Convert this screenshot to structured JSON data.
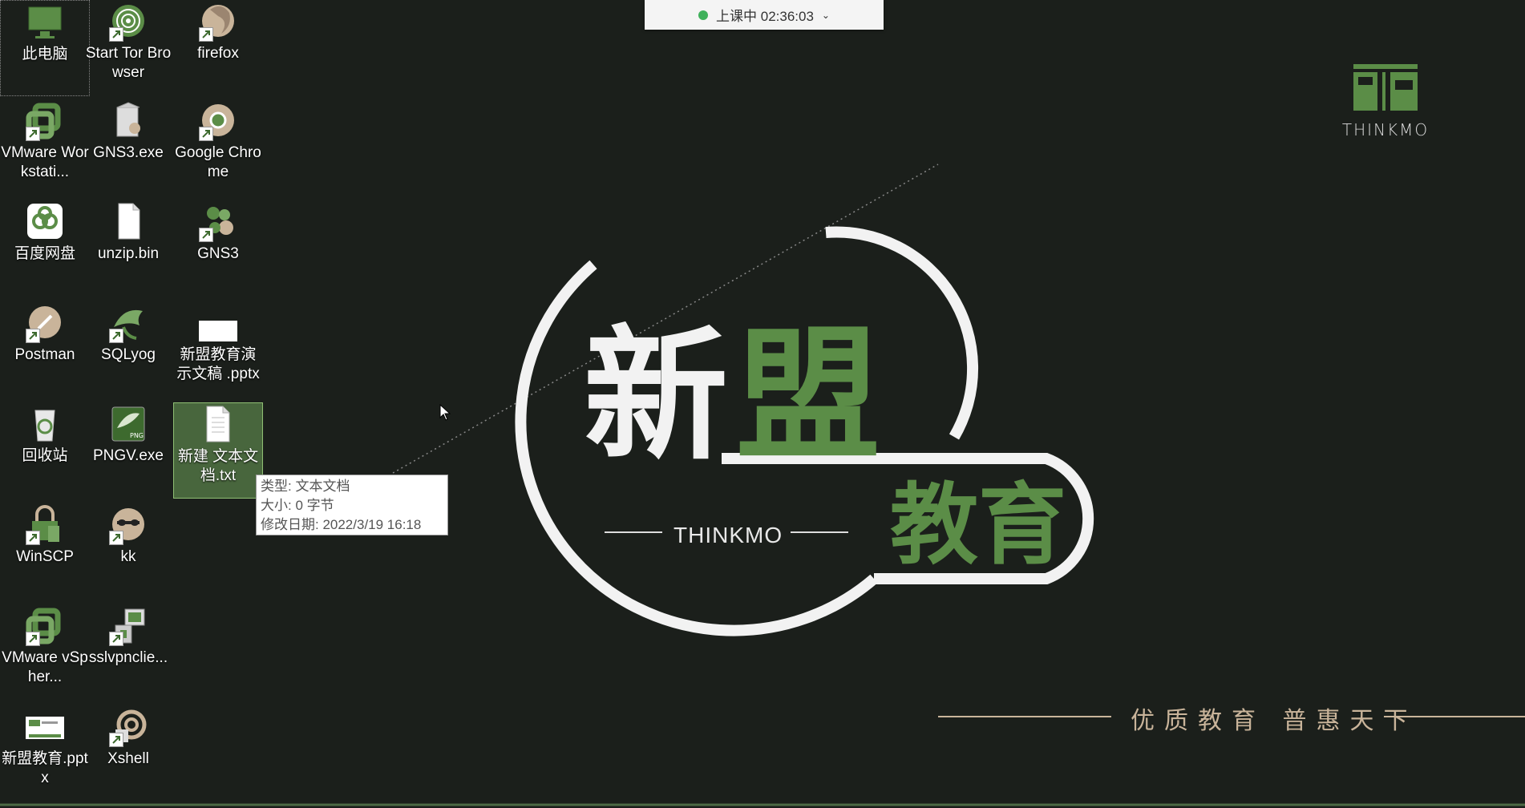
{
  "status_bar": {
    "text": "上课中 02:36:03",
    "status_color": "#3fb15b"
  },
  "desktop_icons": [
    {
      "label": "此电脑",
      "icon": "computer-icon",
      "shortcut": false
    },
    {
      "label": "VMware Workstati...",
      "icon": "vmware-icon",
      "shortcut": true
    },
    {
      "label": "百度网盘",
      "icon": "baidu-netdisk-icon",
      "shortcut": true
    },
    {
      "label": "Postman",
      "icon": "postman-icon",
      "shortcut": true
    },
    {
      "label": "回收站",
      "icon": "recycle-bin-icon",
      "shortcut": false
    },
    {
      "label": "WinSCP",
      "icon": "winscp-icon",
      "shortcut": true
    },
    {
      "label": "VMware vSpher...",
      "icon": "vmware-vsphere-icon",
      "shortcut": true
    },
    {
      "label": "新盟教育.pptx",
      "icon": "pptx-icon",
      "shortcut": false
    },
    {
      "label": "Start Tor Browser",
      "icon": "tor-icon",
      "shortcut": true
    },
    {
      "label": "GNS3.exe",
      "icon": "gns3-installer-icon",
      "shortcut": false
    },
    {
      "label": "unzip.bin",
      "icon": "file-icon",
      "shortcut": false
    },
    {
      "label": "SQLyog",
      "icon": "sqlyog-icon",
      "shortcut": true
    },
    {
      "label": "PNGV.exe",
      "icon": "pngv-icon",
      "shortcut": false
    },
    {
      "label": "kk",
      "icon": "kk-icon",
      "shortcut": true
    },
    {
      "label": "sslvpnclie...",
      "icon": "sslvpn-icon",
      "shortcut": true
    },
    {
      "label": "Xshell",
      "icon": "xshell-icon",
      "shortcut": true
    },
    {
      "label": "firefox",
      "icon": "firefox-icon",
      "shortcut": true
    },
    {
      "label": "Google Chrome",
      "icon": "chrome-icon",
      "shortcut": true
    },
    {
      "label": "GNS3",
      "icon": "gns3-icon",
      "shortcut": true
    },
    {
      "label": "新盟教育演示文稿 .pptx",
      "icon": "pptx-blank-icon",
      "shortcut": false
    },
    {
      "label": "新建 文本文档.txt",
      "icon": "text-file-icon",
      "shortcut": false,
      "selected": true
    }
  ],
  "tooltip": {
    "type": "类型: 文本文档",
    "size": "大小: 0 字节",
    "modified": "修改日期: 2022/3/19 16:18"
  },
  "wallpaper": {
    "top_logo_text": "THINKMO",
    "char_xin": "新",
    "char_meng": "盟",
    "char_edu": "教育",
    "center_brand": "THINKMO",
    "slogan": "优质教育 普惠天下"
  },
  "colors": {
    "brand_green": "#5b8d47",
    "tan": "#c9b49a",
    "background": "#1b1f1b"
  }
}
